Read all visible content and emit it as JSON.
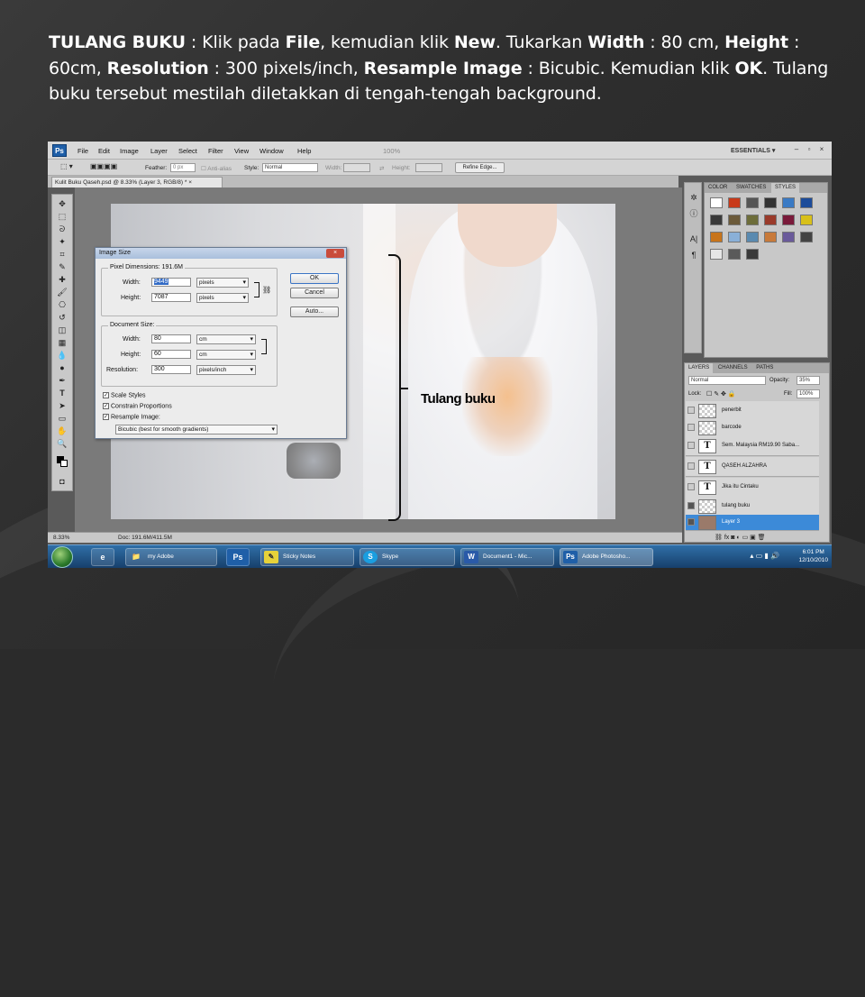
{
  "caption": {
    "p1_b": "TULANG BUKU",
    "p1": " : Klik pada ",
    "p2_b": "File",
    "p2": ", kemudian klik ",
    "p3_b": "New",
    "p3": ". Tukarkan ",
    "p4_b": "Width",
    "p4": " : 80 cm, ",
    "p5_b": "Height",
    "p5": " : 60cm, ",
    "p6_b": "Resolution",
    "p6": " : 300 pixels/inch, ",
    "p7_b": "Resample Image",
    "p7": " : Bicubic. Kemudian klik ",
    "p8_b": "OK",
    "p8": ". Tulang buku tersebut mestilah diletakkan di tengah-tengah background."
  },
  "menubar": {
    "logo": "Ps",
    "items": [
      "File",
      "Edit",
      "Image",
      "Layer",
      "Select",
      "Filter",
      "View",
      "Window",
      "Help"
    ],
    "zoom": "100%",
    "workspace": "ESSENTIALS ▾"
  },
  "options": {
    "feather_label": "Feather:",
    "feather_value": "0 px",
    "antialias": "Anti-alias",
    "style_label": "Style:",
    "style_value": "Normal",
    "width_label": "Width:",
    "height_label": "Height:",
    "refine": "Refine Edge..."
  },
  "document_tab": "Kulit Buku Qaseh.psd @ 8.33% (Layer 3, RGB/8) * ×",
  "dialog": {
    "title": "Image Size",
    "pixel_dimensions": "Pixel Dimensions: 191.6M",
    "width_label": "Width:",
    "width_px": "9449",
    "width_px_unit": "pixels",
    "height_label": "Height:",
    "height_px": "7087",
    "height_px_unit": "pixels",
    "doc_size": "Document Size:",
    "doc_width": "80",
    "doc_width_unit": "cm",
    "doc_height": "60",
    "doc_height_unit": "cm",
    "resolution_label": "Resolution:",
    "resolution": "300",
    "resolution_unit": "pixels/inch",
    "scale_styles": "Scale Styles",
    "constrain": "Constrain Proportions",
    "resample": "Resample Image:",
    "resample_method": "Bicubic (best for smooth gradients)",
    "ok": "OK",
    "cancel": "Cancel",
    "auto": "Auto..."
  },
  "annotation": "Tulang buku",
  "panels": {
    "color_tabs": [
      "COLOR",
      "SWATCHES",
      "STYLES"
    ],
    "layer_tabs": [
      "LAYERS",
      "CHANNELS",
      "PATHS"
    ],
    "blend": "Normal",
    "opacity_label": "Opacity:",
    "opacity": "35%",
    "lock_label": "Lock:",
    "fill_label": "Fill:",
    "fill": "100%",
    "layers": [
      {
        "name": "penerbit",
        "thumb": ""
      },
      {
        "name": "barcode",
        "thumb": ""
      },
      {
        "name": "Sem. Malaysia  RM19.90 Saba...",
        "thumb": "T"
      },
      {
        "name": "QASEH ALZAHRA",
        "thumb": "T"
      },
      {
        "name": "Jika itu Cintaku",
        "thumb": "T"
      },
      {
        "name": "tulang buku",
        "thumb": ""
      },
      {
        "name": "Layer 3",
        "thumb": ""
      }
    ]
  },
  "statusbar": {
    "zoom": "8.33%",
    "doc": "Doc: 191.6M/411.5M"
  },
  "taskbar": {
    "buttons": [
      {
        "label": "my Adobe",
        "icon": "📁"
      },
      {
        "label": "Ps",
        "icon": ""
      },
      {
        "label": "Sticky Notes",
        "icon": "✎"
      },
      {
        "label": "Skype",
        "icon": "S"
      },
      {
        "label": "Document1 - Mic...",
        "icon": "W"
      },
      {
        "label": "Adobe Photosho...",
        "icon": "Ps"
      }
    ],
    "time": "6:01 PM",
    "date": "12/10/2010"
  },
  "colors": {
    "ps_blue": "#1f5fa8",
    "layer_active": "#3c8ad8",
    "taskbar": "#2f6fa7"
  }
}
